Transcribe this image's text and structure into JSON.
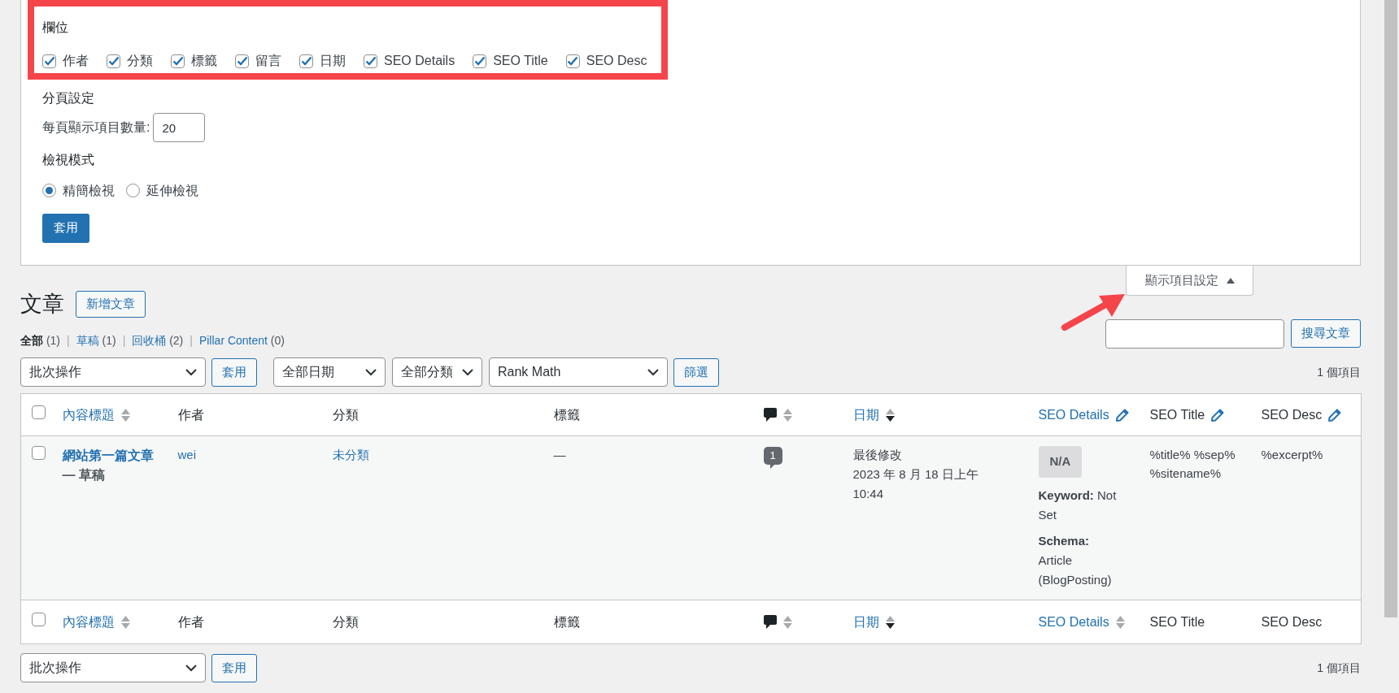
{
  "screen_options": {
    "columns_title": "欄位",
    "columns": [
      {
        "label": "作者",
        "checked": true
      },
      {
        "label": "分類",
        "checked": true
      },
      {
        "label": "標籤",
        "checked": true
      },
      {
        "label": "留言",
        "checked": true
      },
      {
        "label": "日期",
        "checked": true
      },
      {
        "label": "SEO Details",
        "checked": true
      },
      {
        "label": "SEO Title",
        "checked": true
      },
      {
        "label": "SEO Desc",
        "checked": true
      }
    ],
    "pagination_title": "分頁設定",
    "per_page_label": "每頁顯示項目數量:",
    "per_page_value": "20",
    "view_mode_title": "檢視模式",
    "view_modes": [
      {
        "label": "精簡檢視",
        "selected": true
      },
      {
        "label": "延伸檢視",
        "selected": false
      }
    ],
    "apply_button": "套用"
  },
  "screen_options_tab": {
    "label": "顯示項目設定",
    "expanded": true
  },
  "page_title": "文章",
  "add_new_button": "新增文章",
  "status_filters": [
    {
      "label": "全部",
      "count": "(1)",
      "selected": true
    },
    {
      "separator": "|",
      "label": "草稿",
      "count": "(1)",
      "selected": false
    },
    {
      "separator": "|",
      "label": "回收桶",
      "count": "(2)",
      "selected": false
    },
    {
      "separator": "|",
      "label": "Pillar Content",
      "count": "(0)",
      "selected": false
    }
  ],
  "search_button": "搜尋文章",
  "top_nav": {
    "bulk_action": "批次操作",
    "apply_button": "套用",
    "filters": [
      "全部日期",
      "全部分類",
      "Rank Math"
    ],
    "filter_button": "篩選",
    "items_count": "1 個項目"
  },
  "header_columns": [
    {
      "kind": "check",
      "checked": false
    },
    {
      "kind": "text",
      "label": "內容標題",
      "link": true,
      "sortable": true,
      "sorted": false
    },
    {
      "kind": "text",
      "label": "作者"
    },
    {
      "kind": "text",
      "label": "分類"
    },
    {
      "kind": "text",
      "label": "標籤"
    },
    {
      "kind": "comments",
      "sortable": true,
      "sorted": false
    },
    {
      "kind": "text",
      "label": "日期",
      "link": true,
      "sortable": true,
      "sorted": true
    },
    {
      "kind": "text",
      "label": "SEO Details",
      "link": true,
      "editable": true
    },
    {
      "kind": "text",
      "label": "SEO Title",
      "editable": true
    },
    {
      "kind": "text",
      "label": "SEO Desc",
      "editable": true
    }
  ],
  "rows": [
    {
      "checked": false,
      "title": "網站第一篇文章",
      "post_state": "— 草稿",
      "author": "wei",
      "category": "未分類",
      "tags": "—",
      "comments": "1",
      "date_label": "最後修改",
      "date": "2023 年 8 月 18 日上午 10:44",
      "seo_score": "N/A",
      "keyword_label": "Keyword:",
      "keyword": "Not Set",
      "schema_label": "Schema:",
      "schema": "Article (BlogPosting)",
      "seo_title": "%title% %sep% %sitename%",
      "seo_desc": "%excerpt%"
    }
  ],
  "footer_columns": [
    {
      "kind": "check",
      "checked": false
    },
    {
      "kind": "text",
      "label": "內容標題",
      "link": true,
      "sortable": true,
      "sorted": false
    },
    {
      "kind": "text",
      "label": "作者"
    },
    {
      "kind": "text",
      "label": "分類"
    },
    {
      "kind": "text",
      "label": "標籤"
    },
    {
      "kind": "comments",
      "sortable": true,
      "sorted": false
    },
    {
      "kind": "text",
      "label": "日期",
      "link": true,
      "sortable": true,
      "sorted": true
    },
    {
      "kind": "text",
      "label": "SEO Details",
      "link": true,
      "sortable": true,
      "sorted": false
    },
    {
      "kind": "text",
      "label": "SEO Title"
    },
    {
      "kind": "text",
      "label": "SEO Desc"
    }
  ],
  "bottom_nav": {
    "bulk_action": "批次操作",
    "apply_button": "套用",
    "items_count": "1 個項目"
  }
}
